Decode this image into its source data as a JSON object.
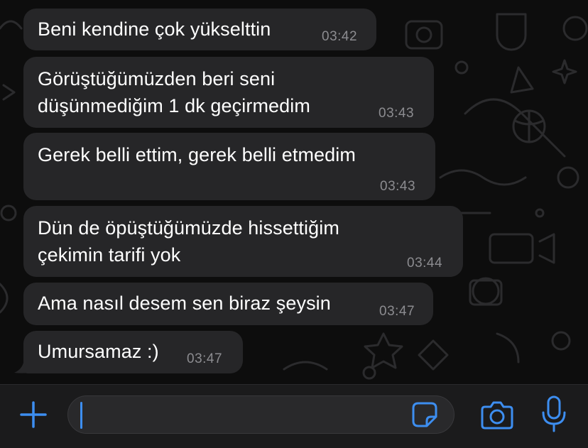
{
  "messages": [
    {
      "text": "Beni kendine çok yükselttin",
      "time": "03:42"
    },
    {
      "text": "Görüştüğümüzden beri seni\ndüşünmediğim 1 dk geçirmedim",
      "time": "03:43"
    },
    {
      "text": "Gerek belli ettim, gerek belli etmedim",
      "time": "03:43"
    },
    {
      "text": "Dün de öpüştüğümüzde hissettiğim\nçekimin tarifi yok",
      "time": "03:44"
    },
    {
      "text": "Ama nasıl desem sen biraz şeysin",
      "time": "03:47"
    },
    {
      "text": "Umursamaz :)",
      "time": "03:47"
    }
  ],
  "colors": {
    "bubble": "#262628",
    "timestamp": "#8c8c90",
    "accent": "#3d8ef0",
    "background": "#0d0d0d"
  },
  "input": {
    "value": "",
    "icons": [
      "plus-icon",
      "sticker-icon",
      "camera-icon",
      "microphone-icon"
    ]
  }
}
